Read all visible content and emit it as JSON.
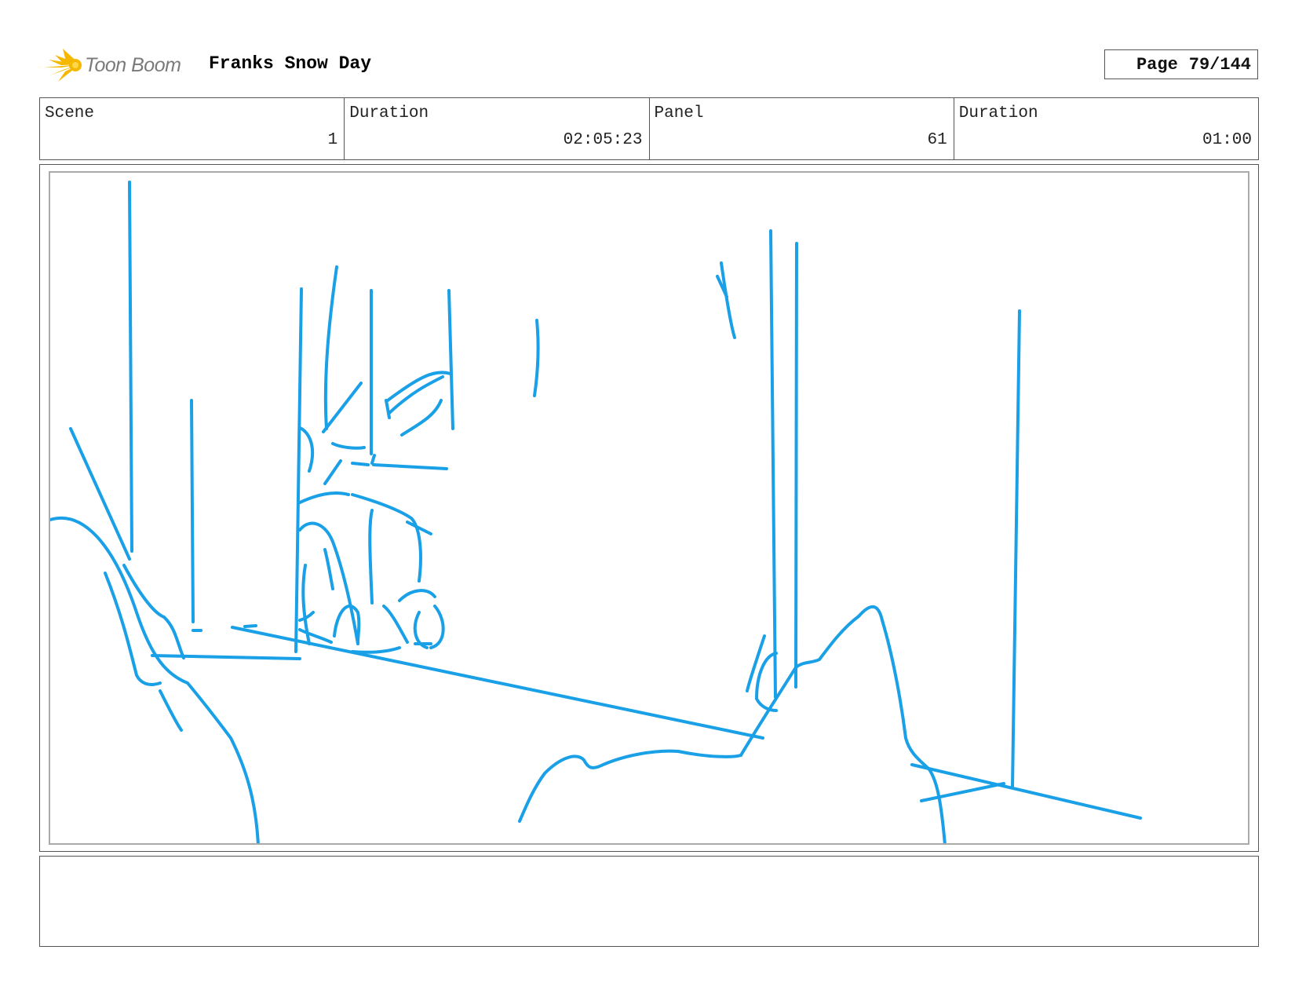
{
  "header": {
    "logo_text": "Toon Boom",
    "project_title": "Franks Snow Day",
    "page_label": "Page",
    "page_number": "79/144"
  },
  "info": {
    "scene_label": "Scene",
    "scene_value": "1",
    "scene_duration_label": "Duration",
    "scene_duration_value": "02:05:23",
    "panel_label": "Panel",
    "panel_value": "61",
    "panel_duration_label": "Duration",
    "panel_duration_value": "01:00"
  },
  "sketch": {
    "stroke_color": "#1aa0e6"
  },
  "logo_colors": {
    "star": "#f5b800",
    "text": "#7a7a7a"
  },
  "notes": {
    "text": ""
  }
}
